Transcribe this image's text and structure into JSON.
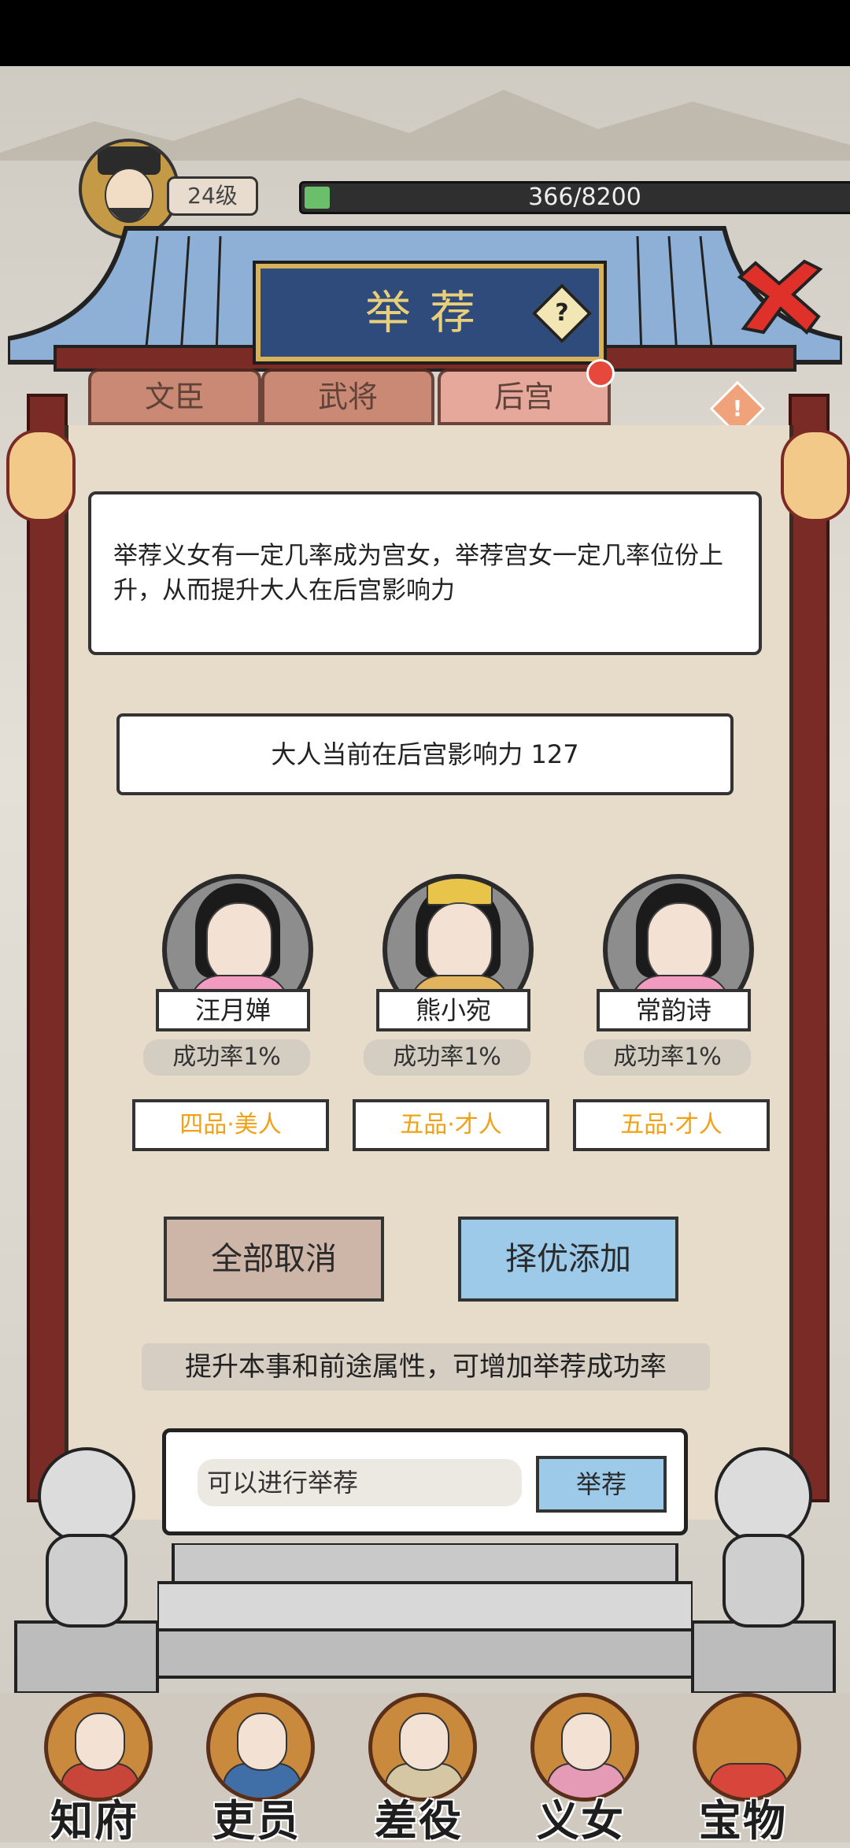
{
  "hud": {
    "level": "24级",
    "xp_text": "366/8200",
    "xp_fraction": 0.045
  },
  "dialog": {
    "title": "举荐",
    "help_glyph": "?",
    "tabs": [
      {
        "label": "文臣",
        "active": false
      },
      {
        "label": "武将",
        "active": false
      },
      {
        "label": "后宫",
        "active": true
      }
    ],
    "info_glyph": "!",
    "description": "举荐义女有一定几率成为宫女，举荐宫女一定几率位份上升，从而提升大人在后宫影响力",
    "influence": "大人当前在后宫影响力 127",
    "candidates": [
      {
        "name": "汪月婵",
        "rate": "成功率1%",
        "rank": "四品·美人",
        "robe": "pink"
      },
      {
        "name": "熊小宛",
        "rate": "成功率1%",
        "rank": "五品·才人",
        "robe": "gold"
      },
      {
        "name": "常韵诗",
        "rate": "成功率1%",
        "rank": "五品·才人",
        "robe": "pink"
      }
    ],
    "buttons": {
      "cancel_all": "全部取消",
      "auto_add": "择优添加"
    },
    "hint": "提升本事和前途属性，可增加举荐成功率",
    "action_status": "可以进行举荐",
    "action_button": "举荐"
  },
  "bottom_nav": [
    {
      "label": "知府",
      "icon": "magistrate-icon",
      "robe": "#c8453a"
    },
    {
      "label": "吏员",
      "icon": "clerk-icon",
      "robe": "#3f6fa6"
    },
    {
      "label": "差役",
      "icon": "runner-icon",
      "robe": "#d6c7a4"
    },
    {
      "label": "义女",
      "icon": "daughter-icon",
      "robe": "#e59ab6"
    },
    {
      "label": "宝物",
      "icon": "treasure-icon",
      "robe": "#d8453a"
    }
  ],
  "colors": {
    "plaque": "#2e4b7c",
    "plaque_text": "#e9cf7a",
    "rank_text": "#f0a114",
    "auto_button": "#9ccae8",
    "cancel_button": "#cdb5a7"
  }
}
